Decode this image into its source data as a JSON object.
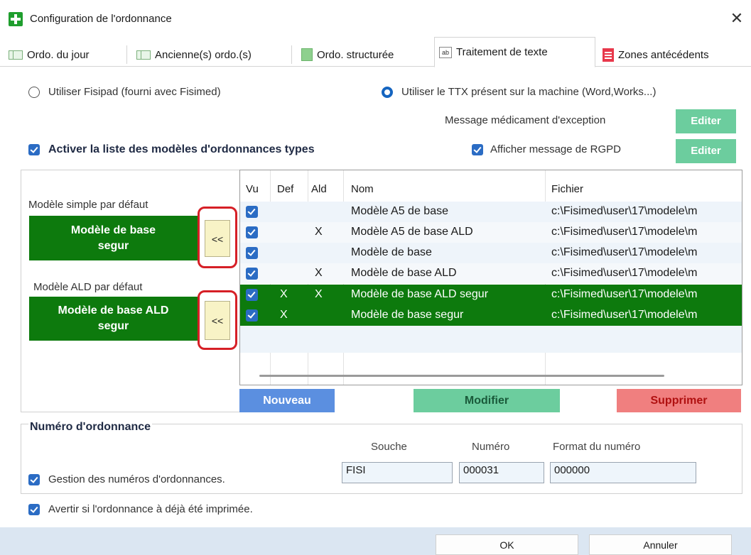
{
  "window": {
    "title": "Configuration de l'ordonnance"
  },
  "tabs": [
    {
      "label": "Ordo. du jour"
    },
    {
      "label": "Ancienne(s) ordo.(s)"
    },
    {
      "label": "Ordo. structurée"
    },
    {
      "label": "Traitement de texte",
      "active": true
    },
    {
      "label": "Zones antécédents"
    }
  ],
  "editor": {
    "option_fisipad": "Utiliser Fisipad (fourni avec Fisimed)",
    "option_ttx": "Utiliser le TTX  présent sur la machine (Word,Works...)",
    "selected": "ttx",
    "msg_exception_label": "Message médicament d'exception",
    "msg_exception_button": "Editer",
    "activate_list_label": "Activer la liste des modèles d'ordonnances types",
    "rgpd_label": "Afficher message de RGPD",
    "rgpd_button": "Editer"
  },
  "defaults": {
    "simple_label": "Modèle simple par défaut",
    "simple_value_line1": "Modèle de base",
    "simple_value_line2": "segur",
    "ald_label": "Modèle ALD par défaut",
    "ald_value_line1": "Modèle de base ALD",
    "ald_value_line2": "segur",
    "arrow": "<<"
  },
  "table": {
    "columns": [
      "Vu",
      "Def",
      "Ald",
      "Nom",
      "Fichier"
    ],
    "rows": [
      {
        "vu": true,
        "def": "",
        "ald": "",
        "nom": "Modèle A5 de base",
        "fichier": "c:\\Fisimed\\user\\17\\modele\\m",
        "selected": false
      },
      {
        "vu": true,
        "def": "",
        "ald": "X",
        "nom": "Modèle A5 de base ALD",
        "fichier": "c:\\Fisimed\\user\\17\\modele\\m",
        "selected": false
      },
      {
        "vu": true,
        "def": "",
        "ald": "",
        "nom": "Modèle de base",
        "fichier": "c:\\Fisimed\\user\\17\\modele\\m",
        "selected": false
      },
      {
        "vu": true,
        "def": "",
        "ald": "X",
        "nom": "Modèle de base ALD",
        "fichier": "c:\\Fisimed\\user\\17\\modele\\m",
        "selected": false
      },
      {
        "vu": true,
        "def": "X",
        "ald": "X",
        "nom": "Modèle de base ALD segur",
        "fichier": "c:\\Fisimed\\user\\17\\modele\\m",
        "selected": true
      },
      {
        "vu": true,
        "def": "X",
        "ald": "",
        "nom": "Modèle de base segur",
        "fichier": "c:\\Fisimed\\user\\17\\modele\\m",
        "selected": true
      }
    ]
  },
  "actions": {
    "new": "Nouveau",
    "modify": "Modifier",
    "delete": "Supprimer"
  },
  "numero": {
    "group_title": "Numéro d'ordonnance",
    "souche_label": "Souche",
    "numero_label": "Numéro",
    "format_label": "Format du numéro",
    "manage_label": "Gestion des numéros d'ordonnances.",
    "souche_value": "FISI",
    "numero_value": "000031",
    "format_value": "000000"
  },
  "warn_printed_label": "Avertir si l'ordonnance à déjà été imprimée.",
  "dialog": {
    "ok": "OK",
    "cancel": "Annuler"
  },
  "colors": {
    "green_selected": "#0d7a0d",
    "accent_blue": "#2b6cc4",
    "btn_new": "#5b8fe0",
    "btn_modify": "#6ccd9e",
    "btn_delete": "#f07f7f",
    "highlight_ring": "#d61f26"
  }
}
